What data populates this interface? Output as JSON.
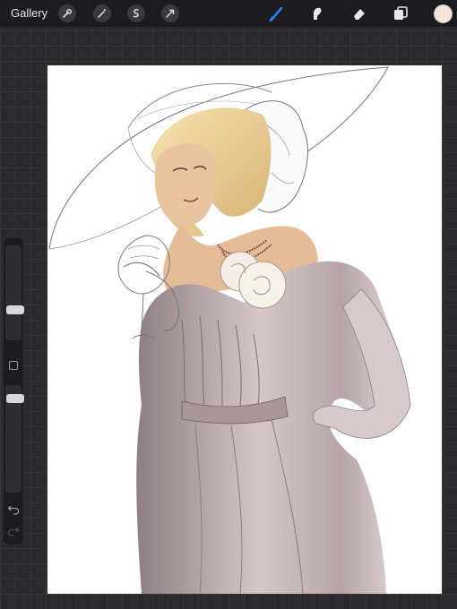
{
  "toolbar": {
    "gallery_label": "Gallery",
    "left_tools": [
      "wrench-icon",
      "magic-wand-icon",
      "selection-icon",
      "transform-arrow-icon"
    ],
    "right_tools": [
      "brush-icon",
      "smudge-icon",
      "eraser-icon",
      "layers-icon"
    ],
    "active_tool": "brush",
    "accent_color": "#2a7bff",
    "current_color": "#f4e4da"
  },
  "sidebar": {
    "brush_size_level": 0.3,
    "opacity_level": 0.9,
    "icons": [
      "modify-square-icon",
      "undo-icon",
      "redo-icon"
    ]
  },
  "canvas": {
    "background": "#ffffff",
    "artwork": "illustration"
  }
}
